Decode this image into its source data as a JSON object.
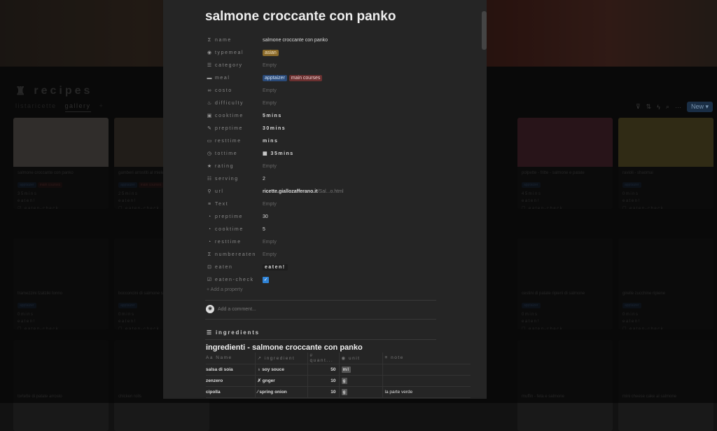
{
  "database": {
    "title": "recipes",
    "views": [
      "listaricette",
      "gallery"
    ],
    "add_view": "+",
    "new_button": "New"
  },
  "cards": [
    {
      "title": "salmone croccante con panko",
      "tags": [
        "apptaizer",
        "main courses"
      ],
      "time": "35mins",
      "eaten": "eaten!",
      "check": "eaten-check",
      "checked": true,
      "img": "#6b6560"
    },
    {
      "title": "gamberi arrostiti al miele",
      "tags": [
        "apptaizer",
        "main courses"
      ],
      "time": "25mins",
      "eaten": "eaten!",
      "check": "eaten-check",
      "checked": false,
      "img": "#4a4038"
    },
    {
      "title": "polpette - fritte - salmone e patate",
      "tags": [
        "apptaizer"
      ],
      "time": "45mins",
      "eaten": "eaten!",
      "check": "eaten-check",
      "checked": false,
      "img": "#5a2e38"
    },
    {
      "title": "ravioli - shaomai",
      "tags": [
        "apptaizer"
      ],
      "time": "0mins",
      "eaten": "eaten!",
      "check": "eaten-check",
      "checked": false,
      "img": "#6a6030"
    },
    {
      "title": "tramezzini tzatziki tonno",
      "tags": [
        "apptaizer"
      ],
      "time": "0mins",
      "eaten": "eaten!",
      "check": "eaten-check",
      "checked": false
    },
    {
      "title": "bocconcini di salmone sp...",
      "tags": [
        "apptaizer"
      ],
      "time": "0mins",
      "eaten": "eaten!",
      "check": "eaten-check",
      "checked": false
    },
    {
      "title": "cestini di patate ripieni di salmone",
      "tags": [
        "apptaizer"
      ],
      "time": "0mins",
      "eaten": "eaten!",
      "check": "eaten-check",
      "checked": false
    },
    {
      "title": "girelle zucchine ripiene",
      "tags": [
        "apptaizer"
      ],
      "time": "0mins",
      "eaten": "eaten!",
      "check": "eaten-check",
      "checked": false
    },
    {
      "title": "tortette di patate arrosto",
      "tags": []
    },
    {
      "title": "chicken rolls",
      "tags": []
    },
    {
      "title": "muffin - feta e salmone",
      "tags": []
    },
    {
      "title": "mini cheese cake al salmone",
      "tags": []
    }
  ],
  "modal": {
    "title": "salmone croccante con panko",
    "properties": [
      {
        "icon": "Σ",
        "label": "name",
        "value": "salmone croccante con panko"
      },
      {
        "icon": "◉",
        "label": "typemeal",
        "pills": [
          {
            "text": "asian",
            "bg": "#8a6a2a",
            "fg": "#f0e0c0"
          }
        ]
      },
      {
        "icon": "☰",
        "label": "category",
        "value": "Empty",
        "empty": true
      },
      {
        "icon": "▬",
        "label": "meal",
        "pills": [
          {
            "text": "apptaizer",
            "bg": "#2a4a78",
            "fg": "#cfe0f5"
          },
          {
            "text": "main courses",
            "bg": "#6a3030",
            "fg": "#f0d0d0"
          }
        ]
      },
      {
        "icon": "∞",
        "label": "costo",
        "value": "Empty",
        "empty": true
      },
      {
        "icon": "♨",
        "label": "difficulty",
        "value": "Empty",
        "empty": true
      },
      {
        "icon": "▣",
        "label": "cooktime",
        "value": "5mins",
        "sp": true
      },
      {
        "icon": "✎",
        "label": "preptime",
        "value": "30mins",
        "sp": true
      },
      {
        "icon": "▭",
        "label": "resttime",
        "value": " mins",
        "sp": true
      },
      {
        "icon": "◷",
        "label": "tottime",
        "value": "▦ 35mins",
        "sp": true
      },
      {
        "icon": "★",
        "label": "rating",
        "value": "Empty",
        "empty": true
      },
      {
        "icon": "☷",
        "label": "serving",
        "value": "2"
      },
      {
        "icon": "⚲",
        "label": "url",
        "value": "ricette.giallozafferano.it",
        "value_suffix": "/Sal...o.html"
      },
      {
        "icon": "≡",
        "label": "Text",
        "value": "Empty",
        "empty": true
      },
      {
        "icon": "◔",
        "label": "preptime",
        "value": "30"
      },
      {
        "icon": "◔",
        "label": "cooktime",
        "value": "5"
      },
      {
        "icon": "◔",
        "label": "resttime",
        "value": "Empty",
        "empty": true
      },
      {
        "icon": "Σ",
        "label": "numbereaten",
        "value": "Empty",
        "empty": true
      },
      {
        "icon": "⊡",
        "label": "eaten",
        "button": "eaten!"
      },
      {
        "icon": "☑",
        "label": "eaten-check",
        "checked": true
      }
    ],
    "add_property": "+ Add a property",
    "comment_placeholder": "Add a comment...",
    "ingredients_heading": "ingredients",
    "db_title": "ingredienti - salmone croccante con panko",
    "columns": [
      "Aa Name",
      "↗ ingredient",
      "# quant...",
      "◉ unit",
      "≡ note"
    ],
    "rows": [
      {
        "name": "salsa di soia",
        "ingredient": "soy souce",
        "quantity": 50,
        "unit": "ml",
        "note": ""
      },
      {
        "name": "zenzero",
        "ingredient": "gnger",
        "quantity": 10,
        "unit": "g",
        "note": ""
      },
      {
        "name": "cipolla",
        "ingredient": "spring onion",
        "quantity": 10,
        "unit": "g",
        "note": "la parte verde"
      }
    ]
  }
}
